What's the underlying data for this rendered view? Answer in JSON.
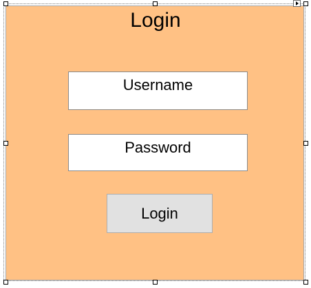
{
  "form": {
    "title": "Login",
    "username_text": "Username",
    "password_text": "Password",
    "login_button_label": "Login"
  },
  "colors": {
    "panel_background": "#ffc184",
    "button_background": "#e1e1e1"
  },
  "icons": {
    "smart_tag": "smart-tag-arrow-icon",
    "resize_handles": "resize-handle-icon"
  }
}
